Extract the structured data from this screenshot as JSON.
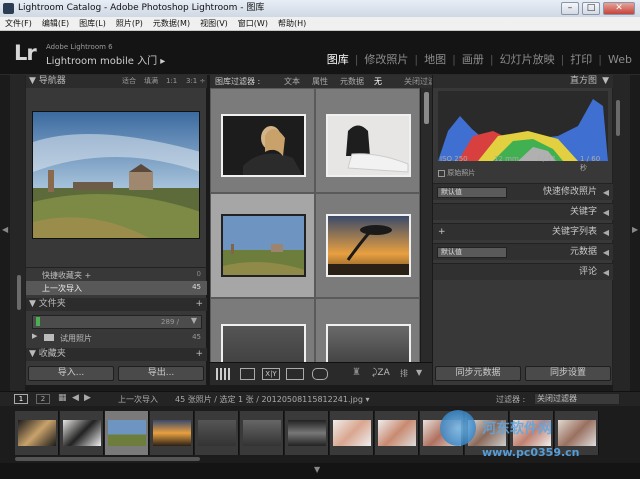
{
  "window": {
    "title": "Lightroom Catalog - Adobe Photoshop Lightroom - 图库"
  },
  "menubar": [
    "文件(F)",
    "编辑(E)",
    "图库(L)",
    "照片(P)",
    "元数据(M)",
    "视图(V)",
    "窗口(W)",
    "帮助(H)"
  ],
  "identity": {
    "logo": "Lr",
    "version": "Adobe Lightroom 6",
    "mobile": "Lightroom mobile 入门  ▸"
  },
  "modules": [
    {
      "label": "图库",
      "active": true
    },
    {
      "label": "修改照片"
    },
    {
      "label": "地图"
    },
    {
      "label": "画册"
    },
    {
      "label": "幻灯片放映"
    },
    {
      "label": "打印"
    },
    {
      "label": "Web"
    }
  ],
  "navigator": {
    "title": "导航器",
    "zoom": [
      "适合",
      "填满",
      "1:1",
      "3:1 ÷"
    ]
  },
  "collections_quick": [
    {
      "label": "快捷收藏夹 +",
      "count": "0"
    },
    {
      "label": "上一次导入",
      "count": "45"
    }
  ],
  "folders": {
    "title": "文件夹",
    "volume_count": "289 /",
    "items": [
      {
        "label": "试用照片",
        "count": "45"
      }
    ]
  },
  "collections": {
    "title": "收藏夹"
  },
  "left_buttons": {
    "import": "导入...",
    "export": "导出..."
  },
  "filter_bar": {
    "label": "图库过滤器 :",
    "options": [
      "文本",
      "属性",
      "元数据",
      "无"
    ],
    "active": "无",
    "preset": "关闭过滤"
  },
  "grid_toolbar": {
    "sort_label": "排"
  },
  "histogram": {
    "title": "直方图",
    "iso": "ISO 250",
    "focal": "12 mm",
    "aperture": "f / 11",
    "shutter": "1 / 60 秒",
    "original": "原始照片"
  },
  "right_sections": [
    {
      "label": "快速修改照片",
      "combo": "默认值"
    },
    {
      "label": "关键字"
    },
    {
      "label": "关键字列表",
      "plus": "+"
    },
    {
      "label": "元数据",
      "combo": "默认值"
    },
    {
      "label": "评论"
    }
  ],
  "right_buttons": {
    "sync_meta": "同步元数据",
    "sync_settings": "同步设置"
  },
  "filmstrip_bar": {
    "page1": "1",
    "page2": "2",
    "source": "上一次导入",
    "info": "45 张照片 / 选定 1 张 / 20120508115812241.jpg ▾",
    "filter_label": "过滤器 :",
    "filter_value": "关闭过滤器"
  },
  "watermark": {
    "text": "www.pc0359.cn",
    "site": "河东软件网"
  },
  "colors": {
    "accent": "#ffffff",
    "panel": "#383838",
    "grid": "#6f6f6f"
  }
}
